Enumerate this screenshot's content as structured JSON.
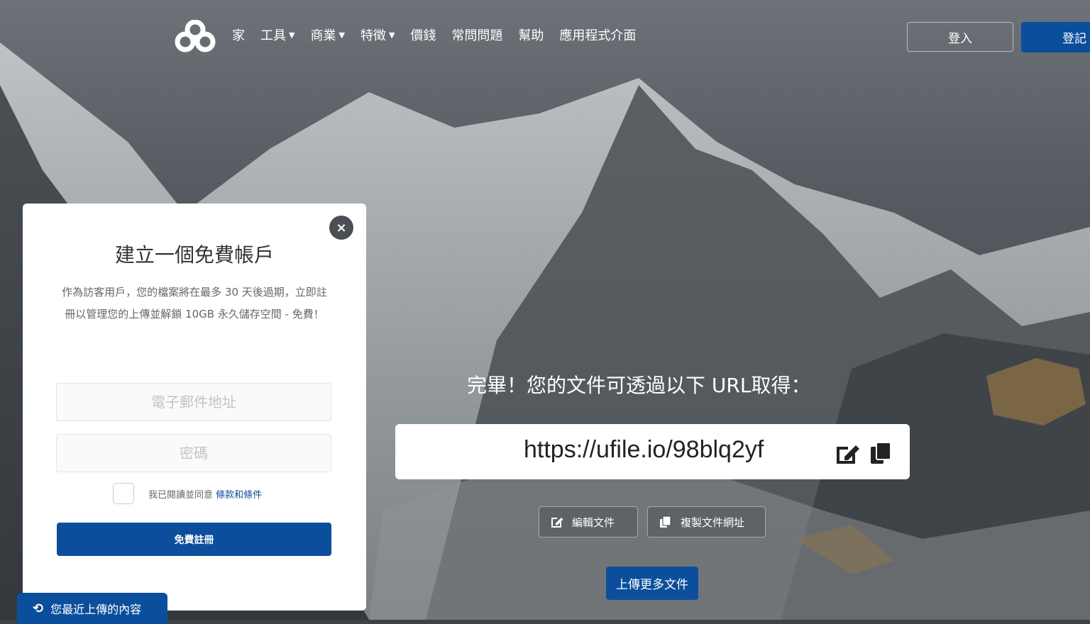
{
  "nav": {
    "items": [
      {
        "label": "家",
        "dropdown": false
      },
      {
        "label": "工具",
        "dropdown": true
      },
      {
        "label": "商業",
        "dropdown": true
      },
      {
        "label": "特徵",
        "dropdown": true
      },
      {
        "label": "價錢",
        "dropdown": false
      },
      {
        "label": "常問問題",
        "dropdown": false
      },
      {
        "label": "幫助",
        "dropdown": false
      },
      {
        "label": "應用程式介面",
        "dropdown": false
      }
    ],
    "login_label": "登入",
    "signup_label": "登記"
  },
  "modal": {
    "title": "建立一個免費帳戶",
    "description": "作為訪客用戶，您的檔案將在最多 30 天後過期，立即註冊以管理您的上傳並解鎖 10GB 永久儲存空間 - 免費！",
    "email_placeholder": "電子郵件地址",
    "password_placeholder": "密碼",
    "agree_text": "我已閱讀並同意",
    "terms_link": "條款和條件",
    "register_label": "免費註冊",
    "close_symbol": "×"
  },
  "recent": {
    "label": "您最近上傳的內容",
    "icon": "history-icon"
  },
  "result": {
    "done_text": "完畢！您的文件可透過以下 URL取得：",
    "url": "https://ufile.io/98blq2yf",
    "edit_label": "編輯文件",
    "copy_label": "複製文件網址",
    "upload_more_label": "上傳更多文件"
  },
  "colors": {
    "primary": "#0b4e9b",
    "modal_bg": "#ffffff",
    "close_bg": "#4b4f54"
  }
}
